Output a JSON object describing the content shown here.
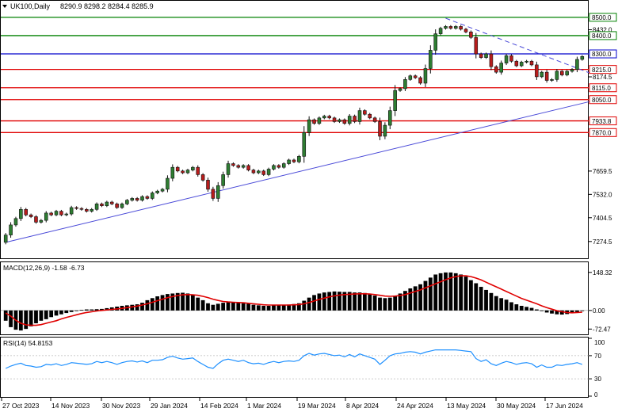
{
  "header": {
    "symbol": "UK100,Daily",
    "ohlc": "8290.9 8298.2 8284.4 8285.9"
  },
  "colors": {
    "bull": "#2e7d32",
    "bear": "#b71c1c",
    "candle_outline": "#111111",
    "green_level": "#008000",
    "red_level": "#e00000",
    "blue_level": "#0000cc",
    "trendline": "#4a4ad8",
    "macd_hist": "#000000",
    "macd_signal": "#e00000",
    "rsi_line": "#1e90ff",
    "label_bg": "#ffffff"
  },
  "chart_data": [
    {
      "type": "candlestick",
      "title": "UK100,Daily",
      "ylim": [
        7200,
        8560
      ],
      "y_ticks": [
        "8432.0",
        "8174.5",
        "7659.5",
        "7532.0",
        "7404.5",
        "7274.5"
      ],
      "x_ticks": [
        "27 Oct 2023",
        "14 Nov 2023",
        "30 Nov 2023",
        "29 Jan 2024",
        "14 Feb 2024",
        "1 Mar 2024",
        "19 Mar 2024",
        "8 Apr 2024",
        "24 Apr 2024",
        "13 May 2024",
        "30 May 2024",
        "17 Jun 2024"
      ],
      "levels": [
        {
          "value": 8500.0,
          "label": "8500.0",
          "style": "green"
        },
        {
          "value": 8400.0,
          "label": "8400.0",
          "style": "green"
        },
        {
          "value": 8300.0,
          "label": "8300.0",
          "style": "blue"
        },
        {
          "value": 8215.0,
          "label": "8215.0",
          "style": "red"
        },
        {
          "value": 8115.0,
          "label": "8115.0",
          "style": "red"
        },
        {
          "value": 8050.0,
          "label": "8050.0",
          "style": "red"
        },
        {
          "value": 7933.8,
          "label": "7933.8",
          "style": "red"
        },
        {
          "value": 7870.0,
          "label": "7870.0",
          "style": "red"
        }
      ],
      "closes": [
        7310,
        7365,
        7400,
        7450,
        7420,
        7410,
        7380,
        7390,
        7430,
        7420,
        7440,
        7420,
        7425,
        7460,
        7455,
        7450,
        7440,
        7450,
        7480,
        7470,
        7490,
        7480,
        7460,
        7480,
        7500,
        7510,
        7500,
        7520,
        7510,
        7540,
        7550,
        7560,
        7620,
        7680,
        7660,
        7650,
        7665,
        7680,
        7640,
        7610,
        7560,
        7510,
        7580,
        7640,
        7700,
        7690,
        7680,
        7690,
        7665,
        7650,
        7660,
        7640,
        7670,
        7690,
        7680,
        7700,
        7720,
        7710,
        7740,
        7870,
        7940,
        7920,
        7950,
        7960,
        7950,
        7930,
        7940,
        7920,
        7960,
        7930,
        7990,
        7970,
        7950,
        7930,
        7850,
        7910,
        7990,
        8100,
        8110,
        8160,
        8180,
        8170,
        8140,
        8220,
        8320,
        8410,
        8440,
        8450,
        8440,
        8450,
        8435,
        8420,
        8390,
        8300,
        8280,
        8300,
        8230,
        8200,
        8250,
        8290,
        8260,
        8235,
        8255,
        8260,
        8240,
        8175,
        8200,
        8155,
        8160,
        8205,
        8185,
        8205,
        8215,
        8270,
        8286
      ],
      "trendlines": [
        {
          "name": "ascending support",
          "from": {
            "index": 0,
            "value": 7270
          },
          "to": {
            "index": 114,
            "value": 8040
          }
        },
        {
          "name": "descending resistance",
          "from": {
            "index": 87,
            "value": 8495
          },
          "to": {
            "index": 114,
            "value": 8195
          }
        }
      ]
    },
    {
      "type": "histogram",
      "title": "MACD(12,26,9) -1.58 -6.73",
      "ylim": [
        -90,
        160
      ],
      "y_ticks": [
        "148.32",
        "0.00",
        "-72.47"
      ],
      "series": [
        {
          "name": "MACD",
          "values": [
            -40,
            -65,
            -75,
            -78,
            -72,
            -62,
            -50,
            -40,
            -34,
            -26,
            -20,
            -15,
            -10,
            -6,
            -2,
            2,
            4,
            4,
            5,
            6,
            9,
            12,
            15,
            18,
            20,
            22,
            24,
            30,
            40,
            48,
            55,
            60,
            64,
            66,
            68,
            69,
            66,
            60,
            50,
            40,
            28,
            22,
            26,
            30,
            32,
            32,
            30,
            28,
            26,
            22,
            20,
            18,
            18,
            20,
            22,
            22,
            23,
            25,
            28,
            38,
            50,
            60,
            66,
            70,
            72,
            74,
            73,
            72,
            72,
            70,
            70,
            68,
            64,
            58,
            50,
            48,
            50,
            58,
            66,
            76,
            86,
            94,
            102,
            115,
            128,
            140,
            145,
            148,
            148,
            145,
            140,
            132,
            118,
            106,
            92,
            80,
            68,
            56,
            48,
            42,
            32,
            24,
            18,
            14,
            10,
            4,
            -2,
            -8,
            -12,
            -15,
            -16,
            -14,
            -10,
            -6,
            -2
          ]
        },
        {
          "name": "Signal",
          "values": [
            -10,
            -22,
            -38,
            -50,
            -56,
            -58,
            -58,
            -55,
            -50,
            -45,
            -40,
            -33,
            -27,
            -22,
            -17,
            -12,
            -8,
            -5,
            -2,
            0,
            2,
            4,
            6,
            8,
            11,
            14,
            17,
            21,
            26,
            32,
            38,
            44,
            50,
            54,
            58,
            61,
            62,
            61,
            59,
            55,
            50,
            44,
            39,
            35,
            33,
            32,
            31,
            30,
            28,
            26,
            24,
            22,
            21,
            21,
            21,
            21,
            21,
            22,
            23,
            26,
            31,
            37,
            43,
            48,
            53,
            57,
            60,
            62,
            63,
            64,
            65,
            65,
            64,
            62,
            59,
            56,
            55,
            56,
            58,
            62,
            68,
            74,
            80,
            88,
            96,
            104,
            112,
            120,
            127,
            132,
            135,
            135,
            132,
            126,
            119,
            110,
            101,
            92,
            83,
            74,
            65,
            56,
            47,
            40,
            33,
            26,
            18,
            11,
            5,
            -1,
            -5,
            -8,
            -9,
            -8,
            -7
          ]
        }
      ]
    },
    {
      "type": "line",
      "title": "RSI(14) 54.8153",
      "ylim": [
        0,
        100
      ],
      "y_ticks": [
        "100",
        "70",
        "30",
        "0"
      ],
      "series": [
        {
          "name": "RSI",
          "values": [
            48,
            52,
            55,
            57,
            53,
            52,
            50,
            51,
            55,
            54,
            56,
            53,
            55,
            58,
            57,
            56,
            55,
            56,
            60,
            58,
            60,
            58,
            55,
            58,
            60,
            61,
            59,
            61,
            58,
            62,
            62,
            63,
            67,
            69,
            66,
            64,
            65,
            66,
            60,
            55,
            50,
            48,
            56,
            62,
            64,
            62,
            60,
            62,
            58,
            56,
            57,
            55,
            58,
            60,
            58,
            60,
            61,
            60,
            62,
            70,
            74,
            71,
            73,
            74,
            72,
            70,
            71,
            68,
            72,
            68,
            73,
            70,
            67,
            64,
            55,
            62,
            70,
            73,
            74,
            76,
            77,
            76,
            73,
            76,
            78,
            80,
            80,
            80,
            80,
            80,
            79,
            78,
            77,
            65,
            60,
            63,
            56,
            53,
            57,
            60,
            58,
            55,
            57,
            58,
            56,
            50,
            54,
            50,
            50,
            54,
            53,
            55,
            56,
            58,
            55
          ]
        }
      ]
    }
  ]
}
